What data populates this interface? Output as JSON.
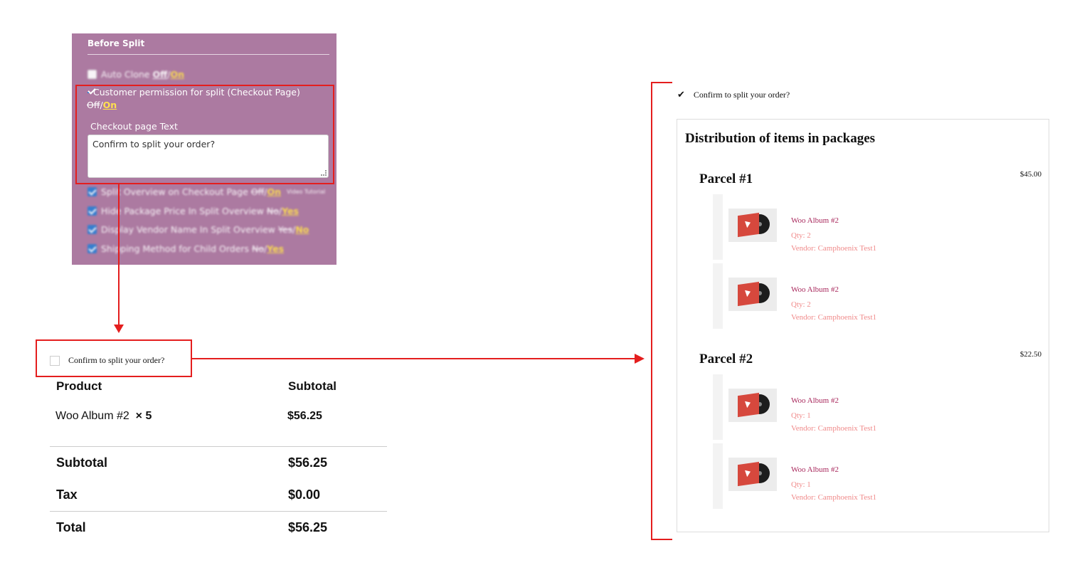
{
  "admin_panel": {
    "section_title": "Before Split",
    "auto_clone": {
      "label": "Auto Clone",
      "off": "Off",
      "on": "On"
    },
    "customer_permission": {
      "label": "Customer permission for split (Checkout Page)",
      "off": "Off",
      "on": "On"
    },
    "checkout_text_label": "Checkout page Text",
    "checkout_text_value": "Confirm to split your order?",
    "split_overview": {
      "label": "Split Overview on Checkout Page",
      "off": "Off",
      "on": "On",
      "extra": "Video Tutorial"
    },
    "hide_package_price": {
      "label": "Hide Package Price In Split Overview",
      "off": "No",
      "on": "Yes"
    },
    "display_vendor": {
      "label": "Display Vendor Name In Split Overview",
      "off": "Yes",
      "on": "No"
    },
    "shipping_method": {
      "label": "Shipping Method for Child Orders",
      "off": "No",
      "on": "Yes"
    }
  },
  "checkout": {
    "confirm_label": "Confirm to split your order?",
    "headers": {
      "product": "Product",
      "subtotal": "Subtotal"
    },
    "item": {
      "name": "Woo Album #2",
      "qty": "× 5",
      "price": "$56.25"
    },
    "subtotal": {
      "label": "Subtotal",
      "value": "$56.25"
    },
    "tax": {
      "label": "Tax",
      "value": "$0.00"
    },
    "total": {
      "label": "Total",
      "value": "$56.25"
    }
  },
  "preview": {
    "confirm_label": "Confirm to split your order?",
    "title": "Distribution of items in packages",
    "parcels": [
      {
        "title": "Parcel #1",
        "price": "$45.00",
        "items": [
          {
            "name": "Woo Album #2",
            "qty": "Qty: 2",
            "vendor": "Vendor: Camphoenix Test1"
          },
          {
            "name": "Woo Album #2",
            "qty": "Qty: 2",
            "vendor": "Vendor: Camphoenix Test1"
          }
        ]
      },
      {
        "title": "Parcel #2",
        "price": "$22.50",
        "items": [
          {
            "name": "Woo Album #2",
            "qty": "Qty: 1",
            "vendor": "Vendor: Camphoenix Test1"
          },
          {
            "name": "Woo Album #2",
            "qty": "Qty: 1",
            "vendor": "Vendor: Camphoenix Test1"
          }
        ]
      }
    ]
  },
  "colors": {
    "panel": "#ac7aa1",
    "annotation": "#e41e1e",
    "highlight_on": "#ffe14d",
    "product_link": "#a8285c",
    "meta_text": "#f08a8a"
  }
}
